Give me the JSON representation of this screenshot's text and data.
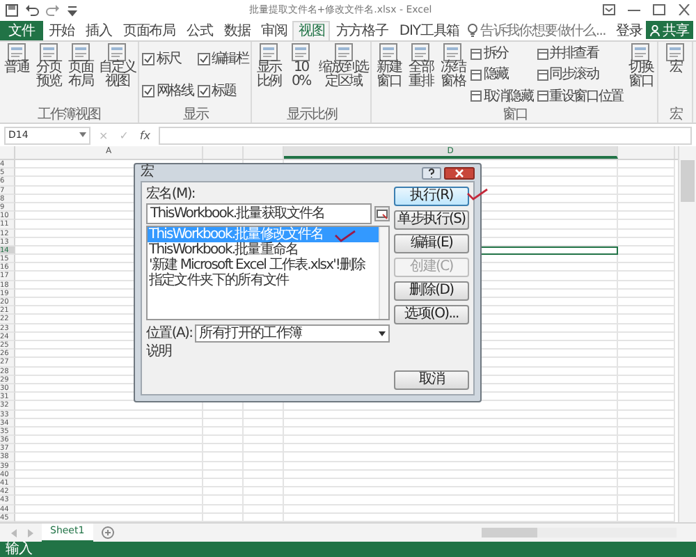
{
  "window": {
    "title": "批量提取文件名+修改文件名.xlsx - Excel"
  },
  "tabs": [
    {
      "label": "文件",
      "selected": false,
      "kind": "file"
    },
    {
      "label": "开始",
      "selected": false,
      "kind": "tab"
    },
    {
      "label": "插入",
      "selected": false,
      "kind": "tab"
    },
    {
      "label": "页面布局",
      "selected": false,
      "kind": "tab"
    },
    {
      "label": "公式",
      "selected": false,
      "kind": "tab"
    },
    {
      "label": "数据",
      "selected": false,
      "kind": "tab"
    },
    {
      "label": "审阅",
      "selected": false,
      "kind": "tab"
    },
    {
      "label": "视图",
      "selected": true,
      "kind": "tab"
    },
    {
      "label": "方方格子",
      "selected": false,
      "kind": "tab"
    },
    {
      "label": "DIY工具箱",
      "selected": false,
      "kind": "tab"
    }
  ],
  "tell_me": {
    "placeholder": "告诉我你想要做什么..."
  },
  "sign_in": "登录",
  "share": "共享",
  "ribbon": [
    {
      "label": "工作簿视图",
      "items": [
        {
          "kind": "large",
          "label": "普通"
        },
        {
          "kind": "large",
          "label": "分页预览"
        },
        {
          "kind": "large",
          "label": "页面布局"
        },
        {
          "kind": "large",
          "label": "自定义视图"
        }
      ]
    },
    {
      "label": "显示",
      "items": [
        {
          "kind": "check",
          "label": "标尺",
          "checked": true
        },
        {
          "kind": "check",
          "label": "网格线",
          "checked": true
        },
        {
          "kind": "check",
          "label": "编辑栏",
          "checked": true
        },
        {
          "kind": "check",
          "label": "标题",
          "checked": true
        }
      ]
    },
    {
      "label": "显示比例",
      "items": [
        {
          "kind": "large",
          "label": "显示比例"
        },
        {
          "kind": "large",
          "label": "100%"
        },
        {
          "kind": "large",
          "label": "缩放到选定区域"
        }
      ]
    },
    {
      "label": "窗口",
      "items": [
        {
          "kind": "large",
          "label": "新建窗口"
        },
        {
          "kind": "large",
          "label": "全部重排"
        },
        {
          "kind": "large",
          "label": "冻结窗格"
        },
        {
          "kind": "small",
          "label": "拆分"
        },
        {
          "kind": "small",
          "label": "隐藏"
        },
        {
          "kind": "small",
          "label": "取消隐藏"
        },
        {
          "kind": "small",
          "label": "并排查看"
        },
        {
          "kind": "small",
          "label": "同步滚动"
        },
        {
          "kind": "small",
          "label": "重设窗口位置"
        },
        {
          "kind": "large",
          "label": "切换窗口"
        }
      ]
    },
    {
      "label": "宏",
      "items": [
        {
          "kind": "large",
          "label": "宏"
        }
      ]
    }
  ],
  "formula_bar": {
    "name_box": "D14",
    "cancel": "×",
    "enter": "✓",
    "fx": "fx"
  },
  "columns": [
    {
      "label": "A",
      "selected": false
    },
    {},
    {},
    {
      "label": "D",
      "selected": true
    },
    {
      "selected": false
    }
  ],
  "rows": [
    {
      "label": "4",
      "selected": false
    },
    {
      "label": "5",
      "selected": false
    },
    {
      "label": "6",
      "selected": false
    },
    {
      "label": "7",
      "selected": false
    },
    {
      "label": "8",
      "selected": false
    },
    {
      "label": "9",
      "selected": false
    },
    {
      "label": "10",
      "selected": false
    },
    {
      "label": "11",
      "selected": false
    },
    {
      "label": "12",
      "selected": false
    },
    {
      "label": "13",
      "selected": false
    },
    {
      "label": "14",
      "selected": true
    },
    {
      "label": "15",
      "selected": false
    },
    {
      "label": "16",
      "selected": false
    },
    {
      "label": "17",
      "selected": false
    },
    {
      "label": "18",
      "selected": false
    },
    {
      "label": "19",
      "selected": false
    },
    {
      "label": "20",
      "selected": false
    },
    {
      "label": "21",
      "selected": false
    },
    {
      "label": "22",
      "selected": false
    },
    {
      "label": "23",
      "selected": false
    },
    {
      "label": "24",
      "selected": false
    },
    {
      "label": "25",
      "selected": false
    },
    {
      "label": "26",
      "selected": false
    },
    {
      "label": "27",
      "selected": false
    },
    {
      "label": "28",
      "selected": false
    },
    {
      "label": "29",
      "selected": false
    },
    {
      "label": "30",
      "selected": false
    },
    {
      "label": "31",
      "selected": false
    },
    {
      "label": "32",
      "selected": false
    },
    {
      "label": "33",
      "selected": false
    },
    {
      "label": "34",
      "selected": false
    },
    {
      "label": "35",
      "selected": false
    },
    {
      "label": "36",
      "selected": false
    },
    {
      "label": "37",
      "selected": false
    },
    {
      "label": "38",
      "selected": false
    },
    {
      "label": "39",
      "selected": false
    },
    {
      "label": "40",
      "selected": false
    },
    {
      "label": "41",
      "selected": false
    },
    {
      "label": "42",
      "selected": false
    },
    {
      "label": "43",
      "selected": false
    },
    {
      "label": "44",
      "selected": false
    },
    {
      "label": "45",
      "selected": false
    }
  ],
  "sheet_tabs": [
    {
      "label": "Sheet1",
      "selected": true
    }
  ],
  "status_bar": "输入",
  "dialog": {
    "title": "宏",
    "name_label": "宏名(M):",
    "name_value": "ThisWorkbook.批量获取文件名",
    "macros": [
      {
        "label": "ThisWorkbook.批量修改文件名",
        "selected": true
      },
      {
        "label": "ThisWorkbook.批量重命名",
        "selected": false
      },
      {
        "label": "'新建 Microsoft Excel 工作表.xlsx'!删除指定文件夹下的所有文件",
        "selected": false
      }
    ],
    "buttons": [
      {
        "label": "执行(R)",
        "disabled": false,
        "default": true
      },
      {
        "label": "单步执行(S)",
        "disabled": false,
        "default": false
      },
      {
        "label": "编辑(E)",
        "disabled": false,
        "default": false
      },
      {
        "label": "创建(C)",
        "disabled": true,
        "default": false
      },
      {
        "label": "删除(D)",
        "disabled": false,
        "default": false
      },
      {
        "label": "选项(O)...",
        "disabled": false,
        "default": false
      }
    ],
    "location_label": "位置(A):",
    "location_value": "所有打开的工作簿",
    "description_label": "说明",
    "cancel": "取消"
  }
}
